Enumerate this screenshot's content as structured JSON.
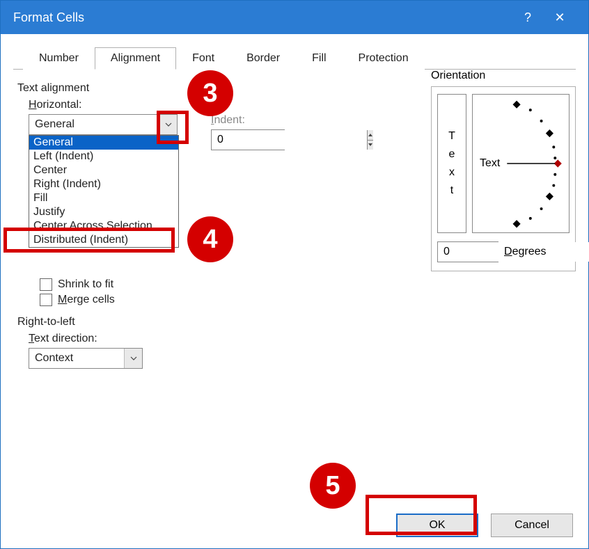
{
  "title": "Format Cells",
  "help_symbol": "?",
  "close_symbol": "✕",
  "tabs": [
    "Number",
    "Alignment",
    "Font",
    "Border",
    "Fill",
    "Protection"
  ],
  "active_tab_index": 1,
  "text_alignment": {
    "section_label": "Text alignment",
    "horizontal_label": "Horizontal:",
    "horizontal_value": "General",
    "horizontal_options": [
      "General",
      "Left (Indent)",
      "Center",
      "Right (Indent)",
      "Fill",
      "Justify",
      "Center Across Selection",
      "Distributed (Indent)"
    ],
    "horizontal_selected_index": 0,
    "indent_label": "Indent:",
    "indent_value": "0"
  },
  "text_control": {
    "shrink_label": "Shrink to fit",
    "merge_label": "Merge cells"
  },
  "rtl": {
    "section_label": "Right-to-left",
    "direction_label": "Text direction:",
    "direction_value": "Context"
  },
  "orientation": {
    "label": "Orientation",
    "vertical_text": [
      "T",
      "e",
      "x",
      "t"
    ],
    "dial_label": "Text",
    "degrees_value": "0",
    "degrees_label": "Degrees"
  },
  "buttons": {
    "ok": "OK",
    "cancel": "Cancel"
  },
  "callouts": {
    "c3": "3",
    "c4": "4",
    "c5": "5"
  }
}
